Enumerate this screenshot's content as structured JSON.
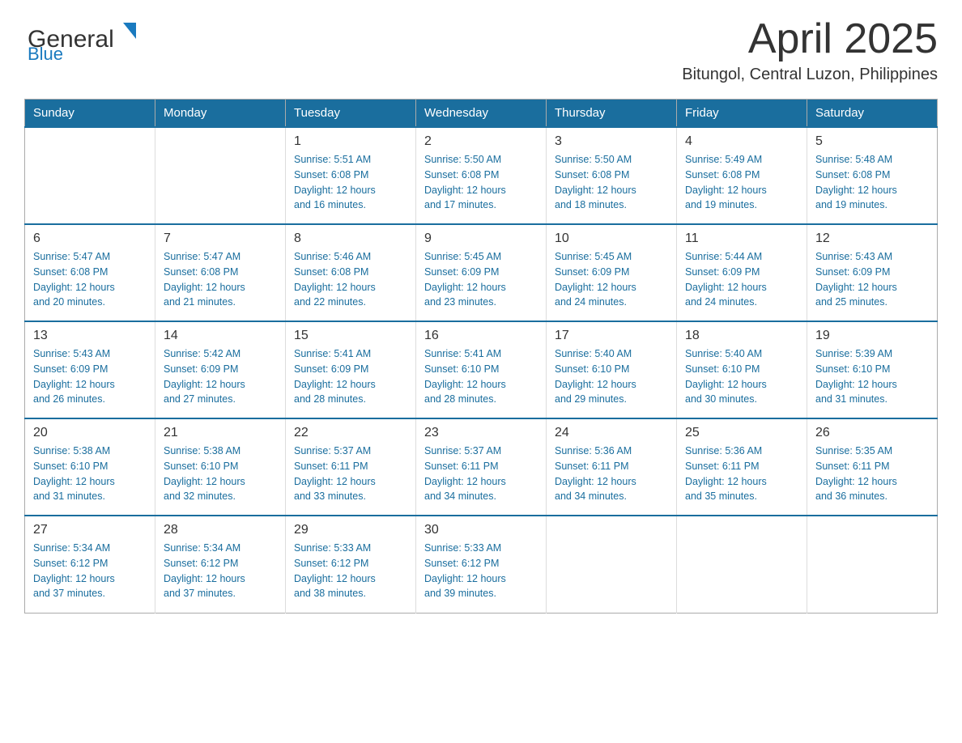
{
  "header": {
    "logo_general": "General",
    "logo_blue": "Blue",
    "month_title": "April 2025",
    "location": "Bitungol, Central Luzon, Philippines"
  },
  "calendar": {
    "headers": [
      "Sunday",
      "Monday",
      "Tuesday",
      "Wednesday",
      "Thursday",
      "Friday",
      "Saturday"
    ],
    "rows": [
      [
        {
          "day": "",
          "info": ""
        },
        {
          "day": "",
          "info": ""
        },
        {
          "day": "1",
          "info": "Sunrise: 5:51 AM\nSunset: 6:08 PM\nDaylight: 12 hours\nand 16 minutes."
        },
        {
          "day": "2",
          "info": "Sunrise: 5:50 AM\nSunset: 6:08 PM\nDaylight: 12 hours\nand 17 minutes."
        },
        {
          "day": "3",
          "info": "Sunrise: 5:50 AM\nSunset: 6:08 PM\nDaylight: 12 hours\nand 18 minutes."
        },
        {
          "day": "4",
          "info": "Sunrise: 5:49 AM\nSunset: 6:08 PM\nDaylight: 12 hours\nand 19 minutes."
        },
        {
          "day": "5",
          "info": "Sunrise: 5:48 AM\nSunset: 6:08 PM\nDaylight: 12 hours\nand 19 minutes."
        }
      ],
      [
        {
          "day": "6",
          "info": "Sunrise: 5:47 AM\nSunset: 6:08 PM\nDaylight: 12 hours\nand 20 minutes."
        },
        {
          "day": "7",
          "info": "Sunrise: 5:47 AM\nSunset: 6:08 PM\nDaylight: 12 hours\nand 21 minutes."
        },
        {
          "day": "8",
          "info": "Sunrise: 5:46 AM\nSunset: 6:08 PM\nDaylight: 12 hours\nand 22 minutes."
        },
        {
          "day": "9",
          "info": "Sunrise: 5:45 AM\nSunset: 6:09 PM\nDaylight: 12 hours\nand 23 minutes."
        },
        {
          "day": "10",
          "info": "Sunrise: 5:45 AM\nSunset: 6:09 PM\nDaylight: 12 hours\nand 24 minutes."
        },
        {
          "day": "11",
          "info": "Sunrise: 5:44 AM\nSunset: 6:09 PM\nDaylight: 12 hours\nand 24 minutes."
        },
        {
          "day": "12",
          "info": "Sunrise: 5:43 AM\nSunset: 6:09 PM\nDaylight: 12 hours\nand 25 minutes."
        }
      ],
      [
        {
          "day": "13",
          "info": "Sunrise: 5:43 AM\nSunset: 6:09 PM\nDaylight: 12 hours\nand 26 minutes."
        },
        {
          "day": "14",
          "info": "Sunrise: 5:42 AM\nSunset: 6:09 PM\nDaylight: 12 hours\nand 27 minutes."
        },
        {
          "day": "15",
          "info": "Sunrise: 5:41 AM\nSunset: 6:09 PM\nDaylight: 12 hours\nand 28 minutes."
        },
        {
          "day": "16",
          "info": "Sunrise: 5:41 AM\nSunset: 6:10 PM\nDaylight: 12 hours\nand 28 minutes."
        },
        {
          "day": "17",
          "info": "Sunrise: 5:40 AM\nSunset: 6:10 PM\nDaylight: 12 hours\nand 29 minutes."
        },
        {
          "day": "18",
          "info": "Sunrise: 5:40 AM\nSunset: 6:10 PM\nDaylight: 12 hours\nand 30 minutes."
        },
        {
          "day": "19",
          "info": "Sunrise: 5:39 AM\nSunset: 6:10 PM\nDaylight: 12 hours\nand 31 minutes."
        }
      ],
      [
        {
          "day": "20",
          "info": "Sunrise: 5:38 AM\nSunset: 6:10 PM\nDaylight: 12 hours\nand 31 minutes."
        },
        {
          "day": "21",
          "info": "Sunrise: 5:38 AM\nSunset: 6:10 PM\nDaylight: 12 hours\nand 32 minutes."
        },
        {
          "day": "22",
          "info": "Sunrise: 5:37 AM\nSunset: 6:11 PM\nDaylight: 12 hours\nand 33 minutes."
        },
        {
          "day": "23",
          "info": "Sunrise: 5:37 AM\nSunset: 6:11 PM\nDaylight: 12 hours\nand 34 minutes."
        },
        {
          "day": "24",
          "info": "Sunrise: 5:36 AM\nSunset: 6:11 PM\nDaylight: 12 hours\nand 34 minutes."
        },
        {
          "day": "25",
          "info": "Sunrise: 5:36 AM\nSunset: 6:11 PM\nDaylight: 12 hours\nand 35 minutes."
        },
        {
          "day": "26",
          "info": "Sunrise: 5:35 AM\nSunset: 6:11 PM\nDaylight: 12 hours\nand 36 minutes."
        }
      ],
      [
        {
          "day": "27",
          "info": "Sunrise: 5:34 AM\nSunset: 6:12 PM\nDaylight: 12 hours\nand 37 minutes."
        },
        {
          "day": "28",
          "info": "Sunrise: 5:34 AM\nSunset: 6:12 PM\nDaylight: 12 hours\nand 37 minutes."
        },
        {
          "day": "29",
          "info": "Sunrise: 5:33 AM\nSunset: 6:12 PM\nDaylight: 12 hours\nand 38 minutes."
        },
        {
          "day": "30",
          "info": "Sunrise: 5:33 AM\nSunset: 6:12 PM\nDaylight: 12 hours\nand 39 minutes."
        },
        {
          "day": "",
          "info": ""
        },
        {
          "day": "",
          "info": ""
        },
        {
          "day": "",
          "info": ""
        }
      ]
    ]
  }
}
